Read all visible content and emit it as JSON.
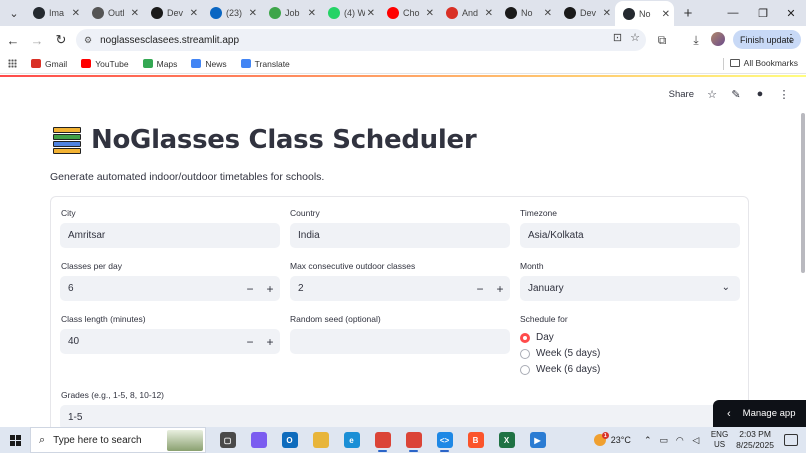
{
  "browser": {
    "tabs": [
      {
        "label": "Ima",
        "icon": "github-icon",
        "color": "#24292f"
      },
      {
        "label": "Outl",
        "icon": "globe-icon",
        "color": "#555555"
      },
      {
        "label": "Dev",
        "icon": "devpost-icon",
        "color": "#1a1a1a"
      },
      {
        "label": "(23)",
        "icon": "linkedin-icon",
        "color": "#0a66c2"
      },
      {
        "label": "Job",
        "icon": "link-icon",
        "color": "#3ea54a"
      },
      {
        "label": "(4) W",
        "icon": "whatsapp-icon",
        "color": "#25d366"
      },
      {
        "label": "Cho",
        "icon": "youtube-icon",
        "color": "#ff0000"
      },
      {
        "label": "And",
        "icon": "gmail-icon",
        "color": "#d93025"
      },
      {
        "label": "No",
        "icon": "devpost-icon",
        "color": "#1a1a1a"
      },
      {
        "label": "Dev",
        "icon": "devpost-icon",
        "color": "#1a1a1a"
      },
      {
        "label": "No",
        "icon": "github-icon",
        "color": "#24292f",
        "active": true
      }
    ],
    "url": "noglassesclasees.streamlit.app",
    "finish_update_label": "Finish update",
    "bookmarks": [
      {
        "label": "Gmail",
        "icon": "gmail-icon",
        "color": "#d93025"
      },
      {
        "label": "YouTube",
        "icon": "youtube-icon",
        "color": "#ff0000"
      },
      {
        "label": "Maps",
        "icon": "maps-icon",
        "color": "#34a853"
      },
      {
        "label": "News",
        "icon": "news-icon",
        "color": "#4285f4"
      },
      {
        "label": "Translate",
        "icon": "translate-icon",
        "color": "#4285f4"
      }
    ],
    "all_bookmarks_label": "All Bookmarks"
  },
  "app": {
    "share_label": "Share",
    "title": "NoGlasses Class Scheduler",
    "subtitle": "Generate automated indoor/outdoor timetables for schools.",
    "fields": {
      "city": {
        "label": "City",
        "value": "Amritsar"
      },
      "country": {
        "label": "Country",
        "value": "India"
      },
      "timezone": {
        "label": "Timezone",
        "value": "Asia/Kolkata"
      },
      "classes_per_day": {
        "label": "Classes per day",
        "value": "6"
      },
      "max_outdoor": {
        "label": "Max consecutive outdoor classes",
        "value": "2"
      },
      "month": {
        "label": "Month",
        "value": "January"
      },
      "class_length": {
        "label": "Class length (minutes)",
        "value": "40"
      },
      "random_seed": {
        "label": "Random seed (optional)",
        "value": ""
      },
      "schedule_for": {
        "label": "Schedule for",
        "options": [
          "Day",
          "Week (5 days)",
          "Week (6 days)"
        ],
        "selected": "Day"
      },
      "grades": {
        "label": "Grades (e.g., 1-5, 8, 10-12)",
        "value": "1-5"
      }
    },
    "stepper_minus": "−",
    "stepper_plus": "+",
    "manage_app_label": "Manage app",
    "accent_color": "#ff4b4b"
  },
  "taskbar": {
    "search_placeholder": "Type here to search",
    "apps": [
      {
        "name": "task-view-icon",
        "glyph": "▢",
        "color": "#4a4a4a"
      },
      {
        "name": "copilot-icon",
        "glyph": "",
        "color": "#7b5cf0"
      },
      {
        "name": "outlook-icon",
        "glyph": "O",
        "color": "#0f6cbd"
      },
      {
        "name": "file-explorer-icon",
        "glyph": "",
        "color": "#e8b53a"
      },
      {
        "name": "edge-icon",
        "glyph": "e",
        "color": "#1b8fd6"
      },
      {
        "name": "chrome-icon",
        "glyph": "",
        "color": "#db4437",
        "running": true
      },
      {
        "name": "chrome-profile-icon",
        "glyph": "",
        "color": "#db4437",
        "running": true
      },
      {
        "name": "vscode-icon",
        "glyph": "<>",
        "color": "#1e88e5",
        "running": true
      },
      {
        "name": "brave-icon",
        "glyph": "B",
        "color": "#fb542b"
      },
      {
        "name": "excel-icon",
        "glyph": "X",
        "color": "#1f7244"
      },
      {
        "name": "azure-data-studio-icon",
        "glyph": "▶",
        "color": "#2b7cd3"
      }
    ],
    "weather_temp": "23°C",
    "weather_badge": "1",
    "lang_line1": "ENG",
    "lang_line2": "US",
    "time": "2:03 PM",
    "date": "8/25/2025"
  }
}
